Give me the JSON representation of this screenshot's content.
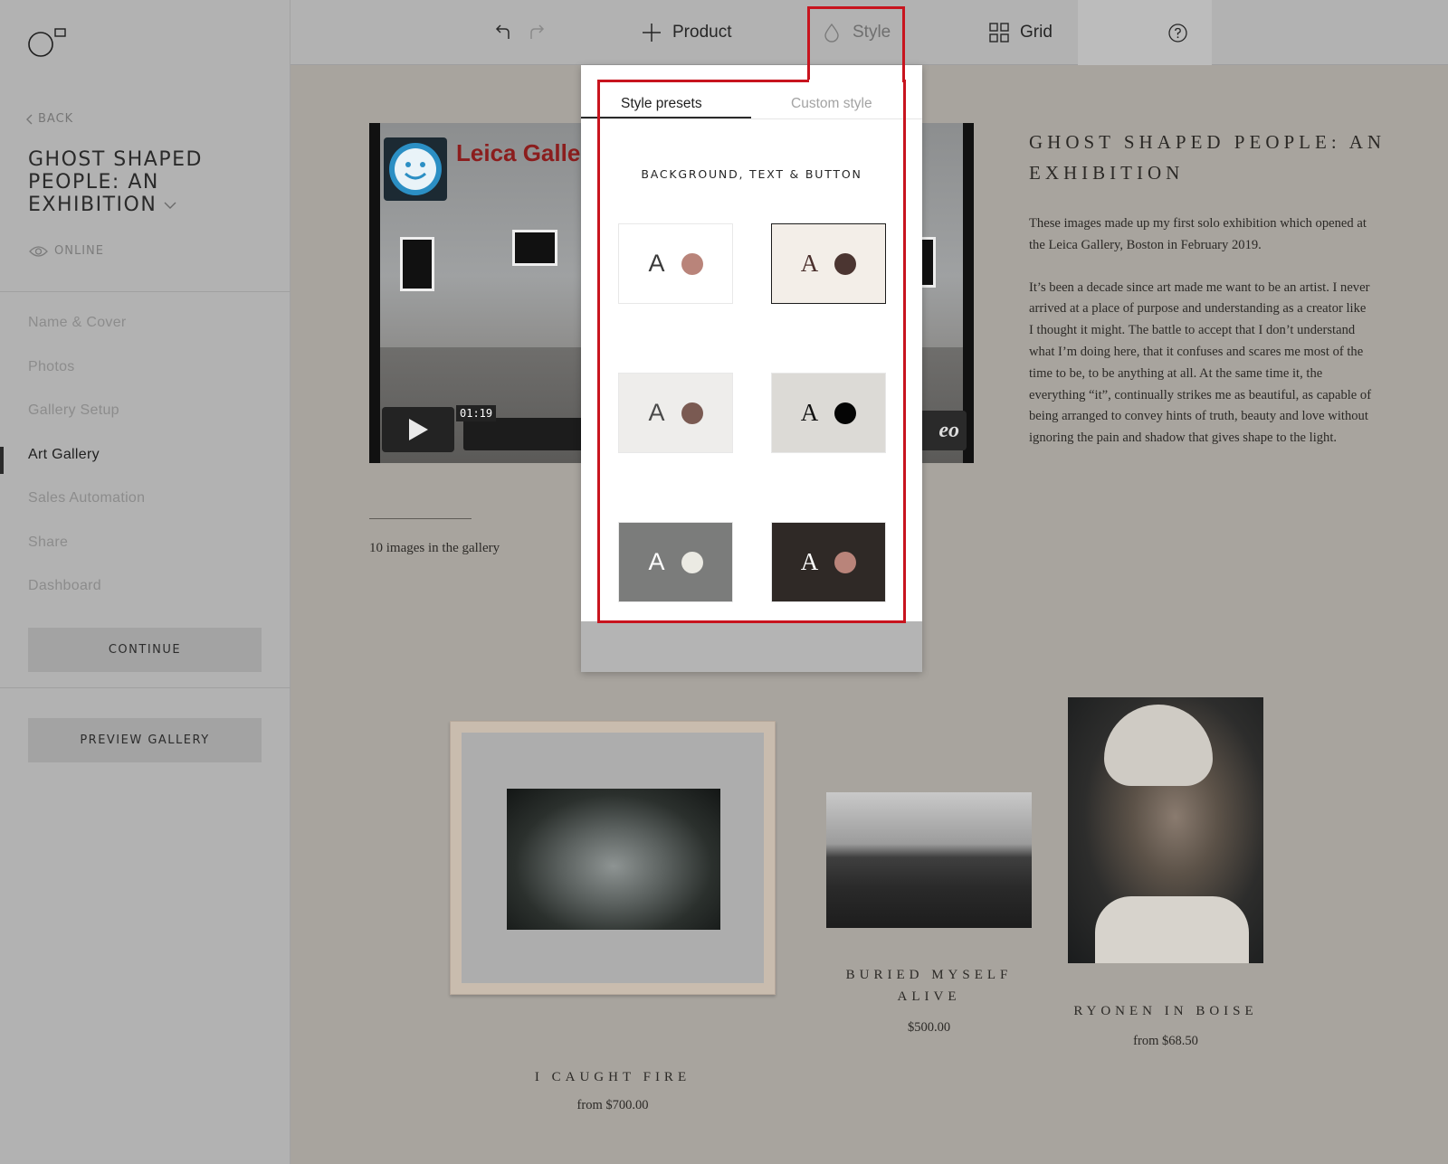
{
  "sidebar": {
    "back_label": "BACK",
    "gallery_title": "GHOST SHAPED PEOPLE: AN EXHIBITION",
    "status_label": "ONLINE",
    "nav": [
      "Name & Cover",
      "Photos",
      "Gallery Setup",
      "Art Gallery",
      "Sales Automation",
      "Share",
      "Dashboard"
    ],
    "active_nav": "Art Gallery",
    "continue_label": "CONTINUE",
    "preview_label": "PREVIEW GALLERY"
  },
  "toolbar": {
    "product_label": "Product",
    "style_label": "Style",
    "grid_label": "Grid",
    "icons": [
      "undo-icon",
      "redo-icon",
      "plus-icon",
      "droplet-icon",
      "grid-icon",
      "help-icon"
    ]
  },
  "style_panel": {
    "tabs": [
      "Style presets",
      "Custom style"
    ],
    "active_tab": "Style presets",
    "section_title": "BACKGROUND, TEXT & BUTTON",
    "presets": [
      {
        "letter": "A",
        "bg": "#ffffff",
        "text": "#3a3a3a",
        "dot": "#b9847a",
        "selected": false
      },
      {
        "letter": "A",
        "bg": "#f3eee8",
        "text": "#4a2f2c",
        "dot": "#4b3531",
        "selected": true
      },
      {
        "letter": "A",
        "bg": "#eeedeb",
        "text": "#4a4a4a",
        "dot": "#7a5a52",
        "selected": false
      },
      {
        "letter": "A",
        "bg": "#dcdad6",
        "text": "#111111",
        "dot": "#050505",
        "selected": false
      },
      {
        "letter": "A",
        "bg": "#7b7c7b",
        "text": "#ffffff",
        "dot": "#ebeae3",
        "selected": false
      },
      {
        "letter": "A",
        "bg": "#2f2926",
        "text": "#ffffff",
        "dot": "#b9847a",
        "selected": false
      }
    ]
  },
  "video": {
    "title": "Leica Galler",
    "time": "01:19",
    "brand": "eo"
  },
  "gallery": {
    "image_count": "10 images in the gallery",
    "exhibit_title": "GHOST SHAPED PEOPLE: AN EXHIBITION",
    "paragraphs": [
      "These images made up my first solo exhibition which opened at the Leica Gallery, Boston in February 2019.",
      "It’s been a decade since art made me want to be an artist. I never arrived at a place of purpose and understanding as a creator like I thought it might. The battle to accept that I don’t understand what I’m doing here, that it confuses and scares me most of the time to be, to be anything at all. At the same time it, the everything “it”, continually strikes me as beautiful, as capable of being arranged to convey hints of truth, beauty and love without ignoring the pain and shadow that gives shape to the light."
    ],
    "artworks": [
      {
        "title": "I CAUGHT FIRE",
        "price": "from $700.00"
      },
      {
        "title": "BURIED MYSELF ALIVE",
        "price": "$500.00"
      },
      {
        "title": "RYONEN IN BOISE",
        "price": "from $68.50"
      }
    ]
  },
  "colors": {
    "highlight": "#c8141e"
  }
}
